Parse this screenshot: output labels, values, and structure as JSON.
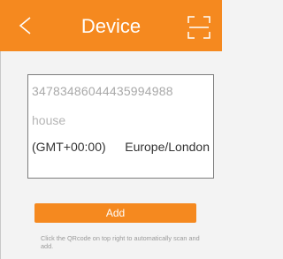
{
  "header": {
    "title": "Device",
    "background": "#f5891f",
    "back_icon": "chevron-left-icon",
    "scan_icon": "qr-scan-icon"
  },
  "form": {
    "device_id": "34783486044435994988",
    "device_name": "house",
    "timezone_offset": "(GMT+00:00)",
    "timezone_city": "Europe/London"
  },
  "actions": {
    "add_label": "Add",
    "hint": "Click the QRcode on top right to automatically scan and add."
  }
}
